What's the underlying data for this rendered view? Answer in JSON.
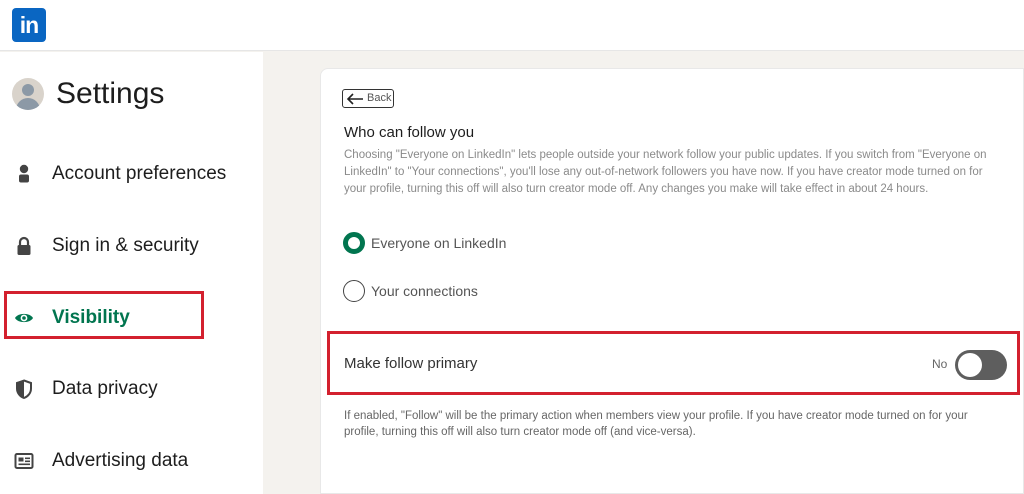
{
  "topbar": {
    "logo_text": "in"
  },
  "sidebar": {
    "title": "Settings",
    "items": [
      {
        "label": "Account preferences",
        "icon": "person-icon",
        "active": false
      },
      {
        "label": "Sign in & security",
        "icon": "lock-icon",
        "active": false
      },
      {
        "label": "Visibility",
        "icon": "eye-icon",
        "active": true
      },
      {
        "label": "Data privacy",
        "icon": "shield-icon",
        "active": false
      },
      {
        "label": "Advertising data",
        "icon": "newspaper-icon",
        "active": false
      }
    ]
  },
  "main": {
    "back_label": "Back",
    "heading": "Who can follow you",
    "description": "Choosing \"Everyone on LinkedIn\" lets people outside your network follow your public updates. If you switch from \"Everyone on LinkedIn\" to \"Your connections\", you'll lose any out-of-network followers you have now. If you have creator mode turned on for your profile, turning this off will also turn creator mode off. Any changes you make will take effect in about 24 hours.",
    "options": [
      {
        "label": "Everyone on LinkedIn",
        "selected": true
      },
      {
        "label": "Your connections",
        "selected": false
      }
    ],
    "follow_primary": {
      "label": "Make follow primary",
      "state_label": "No",
      "enabled": false
    },
    "note": "If enabled, \"Follow\" will be the primary action when members view your profile. If you have creator mode turned on for your profile, turning this off will also turn creator mode off (and vice-versa)."
  },
  "colors": {
    "brand": "#0a66c2",
    "accent_green": "#01754f",
    "highlight_red": "#d3202e",
    "toggle_off": "#5e5e5e"
  }
}
